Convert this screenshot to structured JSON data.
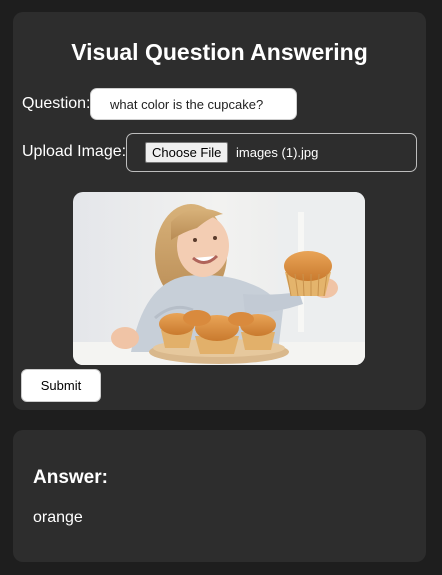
{
  "form": {
    "title": "Visual Question Answering",
    "question_label": "Question:",
    "question_value": "what color is the cupcake?",
    "upload_label": "Upload Image:",
    "choose_file_label": "Choose File",
    "file_name": "images (1).jpg",
    "submit_label": "Submit"
  },
  "answer": {
    "heading": "Answer:",
    "text": "orange"
  },
  "colors": {
    "page_background": "#1e1e1e",
    "card_background": "#2d2d2d",
    "text": "#ffffff"
  }
}
